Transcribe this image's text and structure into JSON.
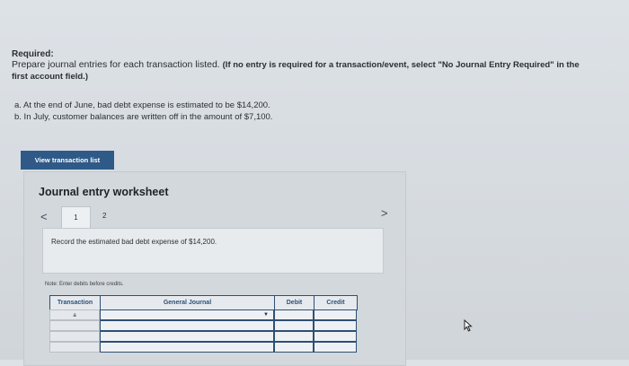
{
  "required": {
    "label": "Required:",
    "instruction": "Prepare journal entries for each transaction listed.",
    "note": "(If no entry is required for a transaction/event, select \"No Journal Entry Required\" in the first account field.)"
  },
  "transactions": [
    "a. At the end of June, bad debt expense is estimated to be $14,200.",
    "b. In July, customer balances are written off in the amount of $7,100."
  ],
  "view_button": "View transaction list",
  "worksheet": {
    "title": "Journal entry worksheet",
    "tabs": [
      "1",
      "2"
    ],
    "description": "Record the estimated bad debt expense of $14,200.",
    "note": "Note: Enter debits before credits.",
    "columns": [
      "Transaction",
      "General Journal",
      "Debit",
      "Credit"
    ],
    "rows": [
      {
        "transaction": "a"
      },
      {
        "transaction": ""
      },
      {
        "transaction": ""
      },
      {
        "transaction": ""
      }
    ],
    "prev_icon": "chevron-left-icon",
    "next_icon": "chevron-right-icon",
    "dropdown_icon": "caret-down-icon"
  }
}
